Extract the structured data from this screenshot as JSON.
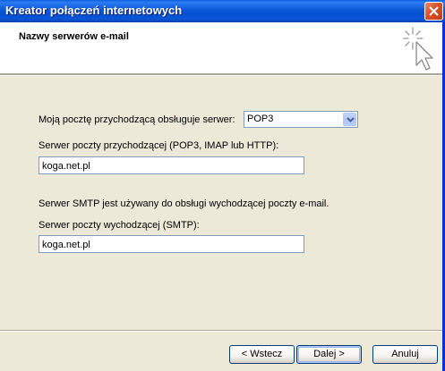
{
  "window": {
    "title": "Kreator połączeń internetowych"
  },
  "header": {
    "title": "Nazwy serwerów e-mail",
    "icon": "wizard-sparkle-cursor-icon"
  },
  "incoming": {
    "server_type_label": "Moją pocztę przychodzącą obsługuje serwer:",
    "server_type_value": "POP3",
    "server_label": "Serwer poczty przychodzącej (POP3, IMAP lub HTTP):",
    "server_value": "koga.net.pl"
  },
  "outgoing": {
    "info_text": "Serwer SMTP jest używany do obsługi wychodzącej poczty e-mail.",
    "server_label": "Serwer poczty wychodzącej (SMTP):",
    "server_value": "koga.net.pl"
  },
  "buttons": {
    "back": "< Wstecz",
    "next": "Dalej >",
    "cancel": "Anuluj"
  },
  "colors": {
    "titlebar": "#0a55d6",
    "dialog_bg": "#ece9d8",
    "close_button": "#d8502a"
  }
}
